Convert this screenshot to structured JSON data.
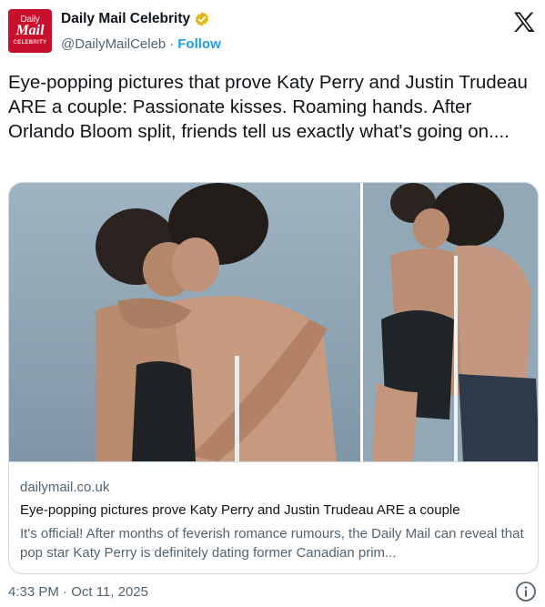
{
  "account": {
    "avatar_lines": [
      "Daily",
      "Mail",
      "CELEBRITY"
    ],
    "display_name": "Daily Mail Celebrity",
    "handle": "@DailyMailCeleb",
    "separator": "·",
    "follow_label": "Follow",
    "brand_color": "#c8102e",
    "verified_color": "#e2b719"
  },
  "tweet": {
    "text": "Eye-popping pictures that prove Katy Perry and Justin Trudeau ARE a couple: Passionate kisses. Roaming hands. After Orlando Bloom split, friends tell us exactly what's going on...."
  },
  "card": {
    "domain": "dailymail.co.uk",
    "title": "Eye-popping pictures prove Katy Perry and Justin Trudeau ARE a couple",
    "description": "It's official! After months of feverish romance rumours, the Daily Mail can reveal that pop star Katy Perry is definitely dating former Canadian prim..."
  },
  "footer": {
    "timestamp": "4:33 PM · Oct 11, 2025"
  },
  "icons": {
    "verified": "verified-badge-icon",
    "platform": "x-logo-icon",
    "info": "info-icon"
  },
  "colors": {
    "link": "#1d9bf0",
    "secondary_text": "#536471",
    "border": "#cfd9de"
  }
}
